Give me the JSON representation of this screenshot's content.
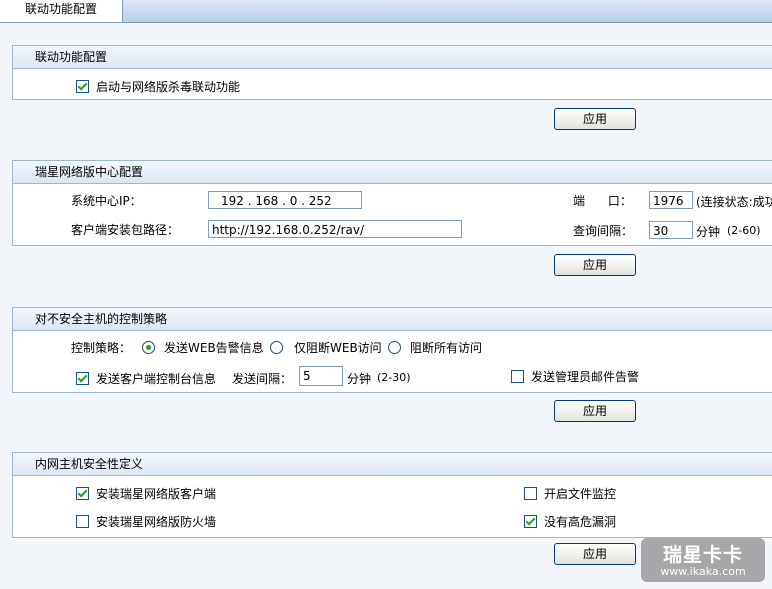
{
  "tab": {
    "label": "联动功能配置"
  },
  "linkage": {
    "title": "联动功能配置",
    "enable_label": "启动与网络版杀毒联动功能",
    "enable_checked": true,
    "apply_label": "应用"
  },
  "center": {
    "title": "瑞星网络版中心配置",
    "ip_label": "系统中心IP：",
    "ip_value": "192 . 168 .  0 . 252",
    "port_label": "端      口：",
    "port_value": "1976",
    "status_text": "(连接状态:成功",
    "path_label": "客户端安装包路径：",
    "path_value": "http://192.168.0.252/rav/",
    "interval_label": "查询间隔：",
    "interval_value": "30",
    "interval_unit": "分钟",
    "interval_range": "(2-60)",
    "apply_label": "应用"
  },
  "policy": {
    "title": "对不安全主机的控制策略",
    "policy_label": "控制策略：",
    "options": [
      {
        "label": "发送WEB告警信息",
        "selected": true
      },
      {
        "label": "仅阻断WEB访问",
        "selected": false
      },
      {
        "label": "阻断所有访问",
        "selected": false
      }
    ],
    "send_console_label": "发送客户端控制台信息",
    "send_console_checked": true,
    "send_interval_label": "发送间隔：",
    "send_interval_value": "5",
    "send_interval_unit": "分钟",
    "send_interval_range": "(2-30)",
    "mail_alert_label": "发送管理员邮件告警",
    "mail_alert_checked": false,
    "apply_label": "应用"
  },
  "security": {
    "title": "内网主机安全性定义",
    "items": [
      {
        "label": "安装瑞星网络版客户端",
        "checked": true
      },
      {
        "label": "开启文件监控",
        "checked": false
      },
      {
        "label": "安装瑞星网络版防火墙",
        "checked": false
      },
      {
        "label": "没有高危漏洞",
        "checked": true
      }
    ],
    "apply_label": "应用"
  },
  "watermark": {
    "brand": "瑞星卡卡",
    "url": "www.ikaka.com"
  }
}
